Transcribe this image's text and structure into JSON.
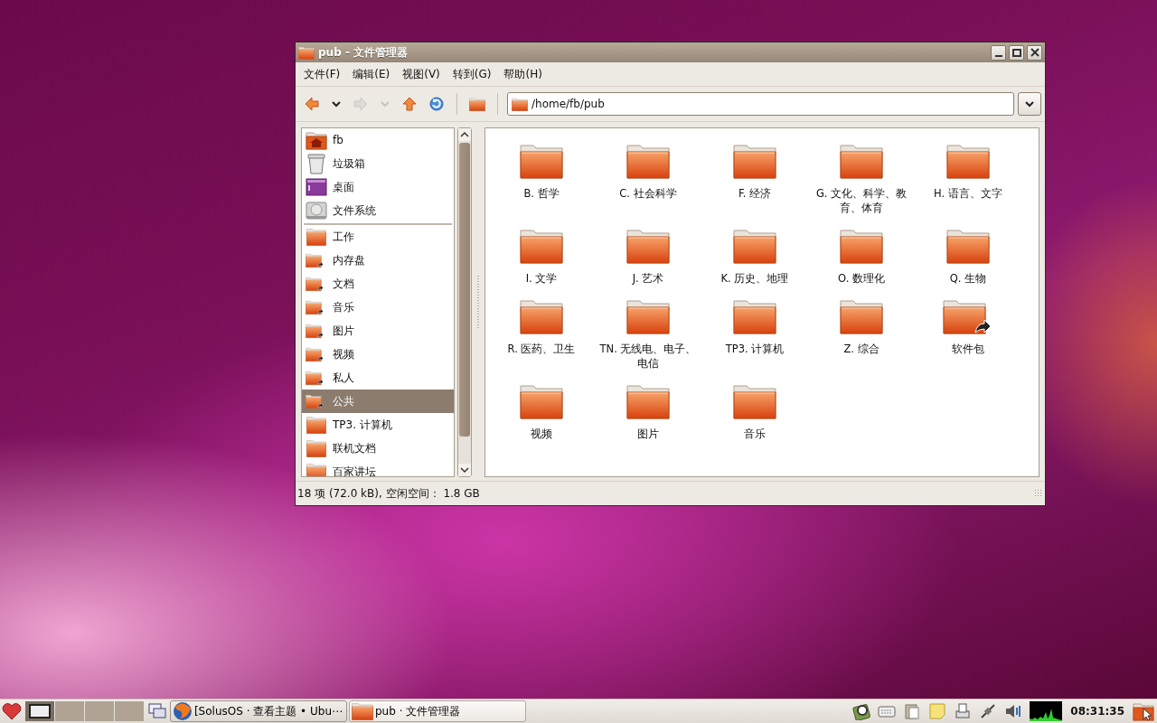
{
  "window": {
    "title": "pub - 文件管理器"
  },
  "menu": [
    {
      "label": "文件(F)"
    },
    {
      "label": "编辑(E)"
    },
    {
      "label": "视图(V)"
    },
    {
      "label": "转到(G)"
    },
    {
      "label": "帮助(H)"
    }
  ],
  "toolbar": [
    {
      "kind": "back",
      "disabled": false
    },
    {
      "kind": "caret",
      "disabled": false
    },
    {
      "kind": "forward",
      "disabled": true
    },
    {
      "kind": "caret",
      "disabled": true
    },
    {
      "kind": "up",
      "disabled": false
    },
    {
      "kind": "reload",
      "disabled": false
    },
    {
      "kind": "separator"
    },
    {
      "kind": "home",
      "disabled": false
    },
    {
      "kind": "separator"
    }
  ],
  "location": {
    "value": "/home/fb/pub"
  },
  "sidebar": {
    "places": [
      {
        "label": "fb",
        "kind": "home",
        "selected": false
      },
      {
        "label": "垃圾箱",
        "kind": "trash",
        "selected": false
      },
      {
        "label": "桌面",
        "kind": "desktop",
        "selected": false
      },
      {
        "label": "文件系统",
        "kind": "drive",
        "selected": false
      }
    ],
    "bookmarks": [
      {
        "label": "工作",
        "kind": "folder",
        "link": false,
        "selected": false
      },
      {
        "label": "内存盘",
        "kind": "folder",
        "link": true,
        "selected": false
      },
      {
        "label": "文档",
        "kind": "folder",
        "link": true,
        "selected": false
      },
      {
        "label": "音乐",
        "kind": "folder",
        "link": true,
        "selected": false
      },
      {
        "label": "图片",
        "kind": "folder",
        "link": true,
        "selected": false
      },
      {
        "label": "视频",
        "kind": "folder",
        "link": true,
        "selected": false
      },
      {
        "label": "私人",
        "kind": "folder",
        "link": true,
        "selected": false
      },
      {
        "label": "公共",
        "kind": "folder",
        "link": true,
        "selected": true
      },
      {
        "label": "TP3. 计算机",
        "kind": "folder",
        "link": false,
        "selected": false
      },
      {
        "label": "联机文档",
        "kind": "folder",
        "link": false,
        "selected": false
      },
      {
        "label": "百家讲坛",
        "kind": "folder",
        "link": false,
        "selected": false
      }
    ]
  },
  "folders": [
    {
      "label": "B. 哲学",
      "link": false
    },
    {
      "label": "C. 社会科学",
      "link": false
    },
    {
      "label": "F. 经济",
      "link": false
    },
    {
      "label": "G. 文化、科学、教育、体育",
      "link": false
    },
    {
      "label": "H. 语言、文字",
      "link": false
    },
    {
      "label": "I. 文学",
      "link": false
    },
    {
      "label": "J. 艺术",
      "link": false
    },
    {
      "label": "K. 历史、地理",
      "link": false
    },
    {
      "label": "O. 数理化",
      "link": false
    },
    {
      "label": "Q. 生物",
      "link": false
    },
    {
      "label": "R. 医药、卫生",
      "link": false
    },
    {
      "label": "TN. 无线电、电子、电信",
      "link": false
    },
    {
      "label": "TP3. 计算机",
      "link": false
    },
    {
      "label": "Z. 综合",
      "link": false
    },
    {
      "label": "软件包",
      "link": true
    },
    {
      "label": "视频",
      "link": false
    },
    {
      "label": "图片",
      "link": false
    },
    {
      "label": "音乐",
      "link": false
    }
  ],
  "status_bar": {
    "text": "18 项 (72.0 kB), 空闲空间： 1.8 GB"
  },
  "taskbar": {
    "workspaces": [
      {
        "selected": true
      },
      {
        "selected": false
      },
      {
        "selected": false
      },
      {
        "selected": false
      }
    ],
    "tasks": [
      {
        "label": "[SolusOS · 查看主题 • Ubu⋯",
        "kind": "browser",
        "selected": false
      },
      {
        "label": "pub · 文件管理器",
        "kind": "folder",
        "selected": true
      }
    ],
    "clock": "08:31:35"
  }
}
